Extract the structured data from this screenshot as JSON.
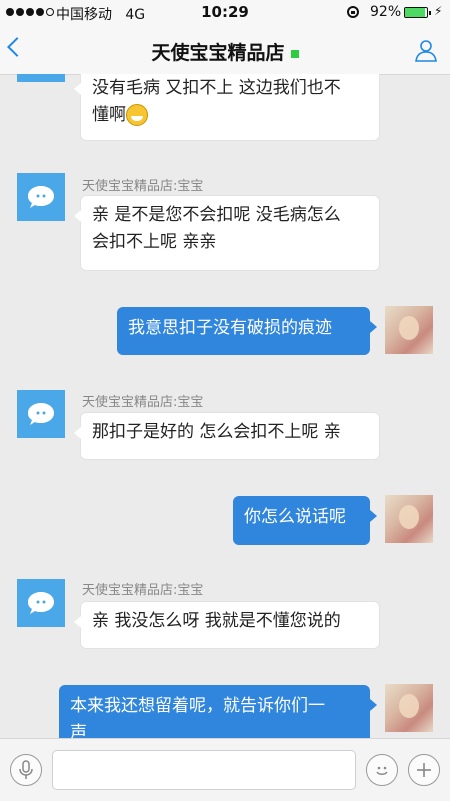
{
  "status_bar": {
    "carrier": "中国移动",
    "network": "4G",
    "time": "10:29",
    "battery_percent": "92%",
    "battery_level": 0.92
  },
  "nav": {
    "title": "天使宝宝精品店",
    "online_color": "#2ecc40"
  },
  "messages": [
    {
      "from": "shop",
      "sender": "",
      "text": "没有毛病 又扣不上 这边我们也不懂啊",
      "line1": "没有毛病 又扣不上 这边我们也不",
      "line2": "懂啊",
      "emoji": "grinning-sweat-emoji"
    },
    {
      "from": "shop",
      "sender": "天使宝宝精品店:宝宝",
      "line1": "亲 是不是您不会扣呢 没毛病怎么",
      "line2": "会扣不上呢 亲亲"
    },
    {
      "from": "me",
      "text": "我意思扣子没有破损的痕迹"
    },
    {
      "from": "shop",
      "sender": "天使宝宝精品店:宝宝",
      "text": "那扣子是好的 怎么会扣不上呢 亲"
    },
    {
      "from": "me",
      "text": "你怎么说话呢"
    },
    {
      "from": "shop",
      "sender": "天使宝宝精品店:宝宝",
      "text": "亲 我没怎么呀 我就是不懂您说的"
    },
    {
      "from": "me",
      "line1": "本来我还想留着呢，就告诉你们一",
      "line2": "声"
    }
  ],
  "input_bar": {
    "placeholder": ""
  },
  "colors": {
    "accent": "#1e88e5",
    "outgoing_bubble": "#2f86dc",
    "bot_avatar": "#4aa8e8"
  }
}
